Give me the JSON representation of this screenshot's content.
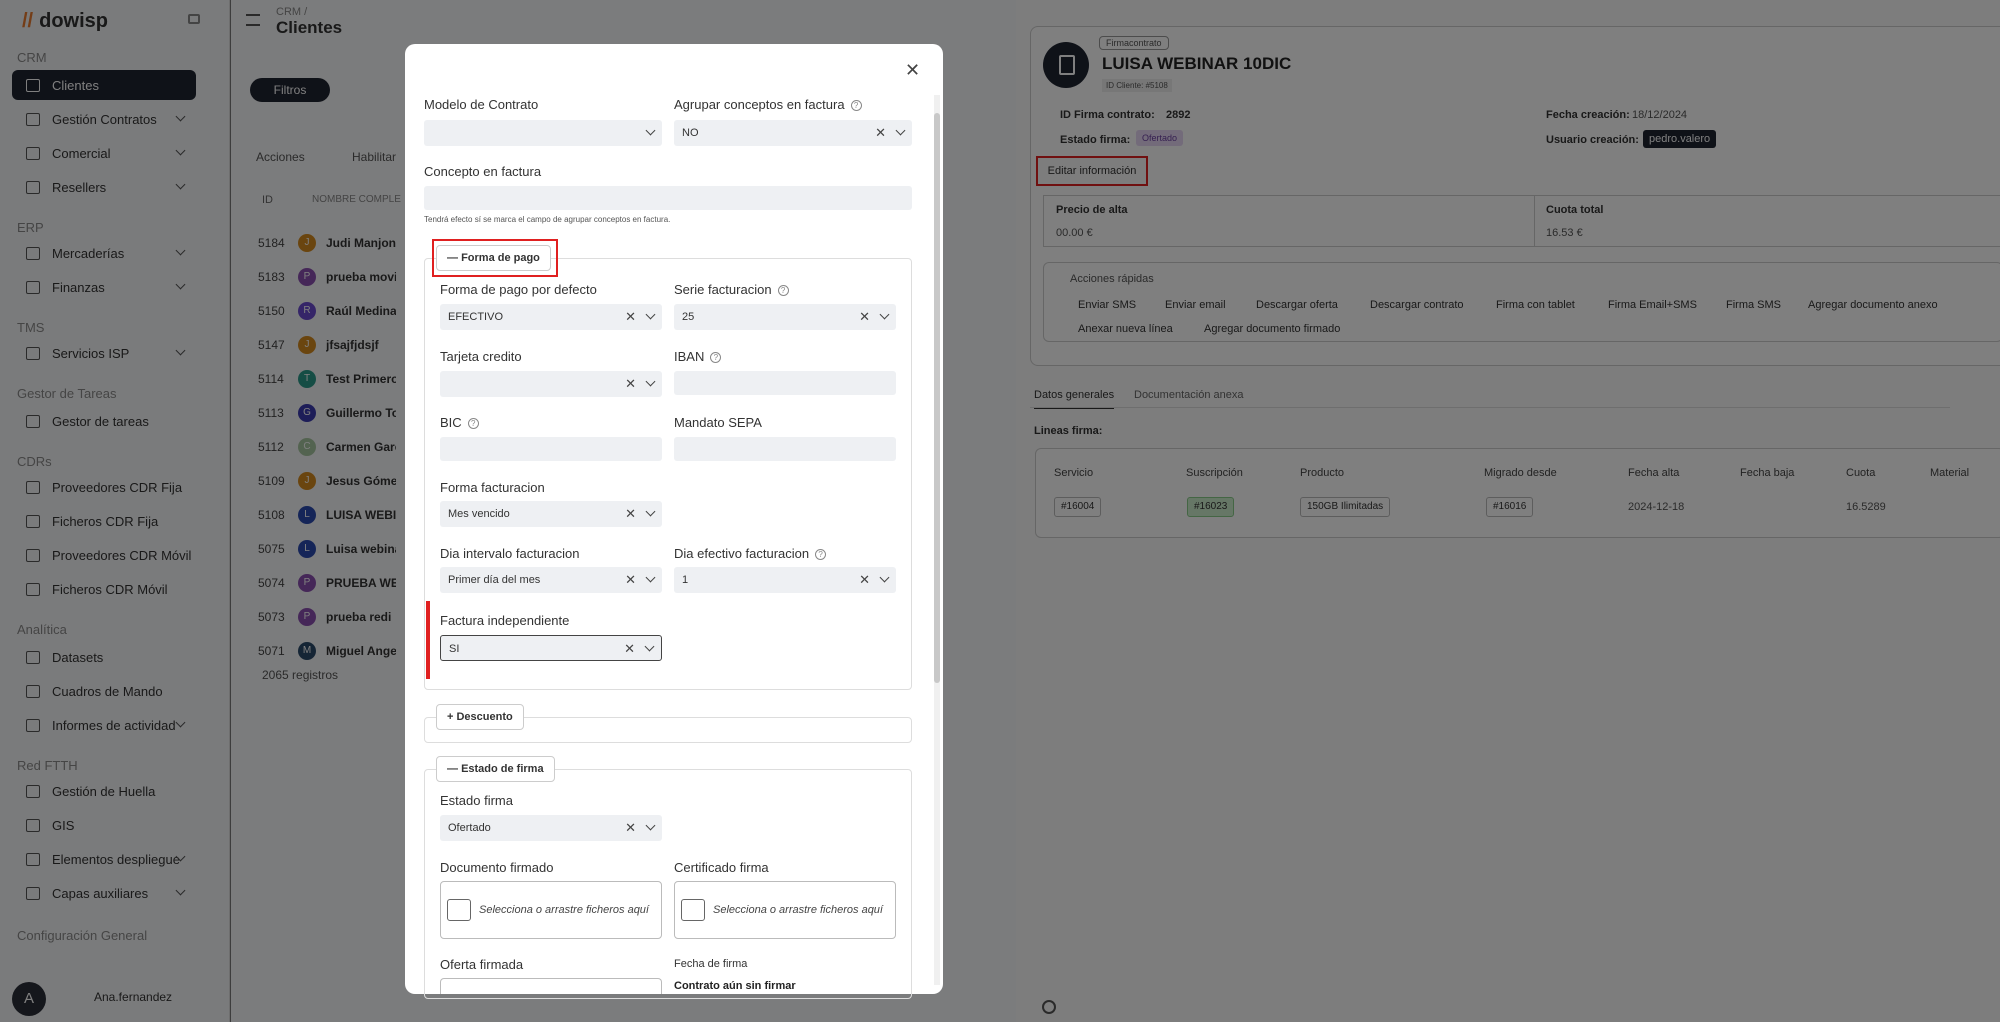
{
  "app": {
    "logo": "dowisp"
  },
  "sidebar": {
    "sections": [
      "CRM",
      "ERP",
      "TMS",
      "Gestor de Tareas",
      "CDRs",
      "Analítica",
      "Red FTTH",
      "Configuración General"
    ],
    "items": [
      {
        "label": "Clientes",
        "active": true
      },
      {
        "label": "Gestión Contratos",
        "chevron": true
      },
      {
        "label": "Comercial",
        "chevron": true
      },
      {
        "label": "Resellers",
        "chevron": true
      },
      {
        "label": "Mercaderías",
        "chevron": true
      },
      {
        "label": "Finanzas",
        "chevron": true
      },
      {
        "label": "Servicios ISP",
        "chevron": true
      },
      {
        "label": "Gestor de tareas"
      },
      {
        "label": "Proveedores CDR Fija"
      },
      {
        "label": "Ficheros CDR Fija"
      },
      {
        "label": "Proveedores CDR Móvil"
      },
      {
        "label": "Ficheros CDR Móvil"
      },
      {
        "label": "Datasets"
      },
      {
        "label": "Cuadros de Mando"
      },
      {
        "label": "Informes de actividad",
        "chevron": true
      },
      {
        "label": "Gestión de Huella"
      },
      {
        "label": "GIS"
      },
      {
        "label": "Elementos despliegue",
        "chevron": true
      },
      {
        "label": "Capas auxiliares",
        "chevron": true
      }
    ],
    "user": {
      "initial": "A",
      "name": "Ana.fernandez"
    }
  },
  "main": {
    "breadcrumb": "CRM /",
    "title": "Clientes",
    "filters": "Filtros",
    "actions": "Acciones",
    "habilitar": "Habilitar",
    "col_id": "ID",
    "col_name": "NOMBRE COMPLE",
    "rows": [
      {
        "id": "5184",
        "initial": "J",
        "name": "Judi Manjon",
        "color": "#d58a1e"
      },
      {
        "id": "5183",
        "initial": "P",
        "name": "prueba movil",
        "color": "#8a4fb0"
      },
      {
        "id": "5150",
        "initial": "R",
        "name": "Raúl Medina",
        "color": "#6a4ad0"
      },
      {
        "id": "5147",
        "initial": "J",
        "name": "jfsajfjdsjf",
        "color": "#d58a1e"
      },
      {
        "id": "5114",
        "initial": "T",
        "name": "Test Primero",
        "color": "#2a9a8a"
      },
      {
        "id": "5113",
        "initial": "G",
        "name": "Guillermo Tor",
        "color": "#3a3ab0"
      },
      {
        "id": "5112",
        "initial": "C",
        "name": "Carmen Garci",
        "color": "#a7c7a0"
      },
      {
        "id": "5109",
        "initial": "J",
        "name": "Jesus Gómez",
        "color": "#d58a1e"
      },
      {
        "id": "5108",
        "initial": "L",
        "name": "LUISA WEBIN",
        "color": "#2a4ab0"
      },
      {
        "id": "5075",
        "initial": "L",
        "name": "Luisa webinar",
        "color": "#2a4ab0"
      },
      {
        "id": "5074",
        "initial": "P",
        "name": "PRUEBA WEB",
        "color": "#8a4fb0"
      },
      {
        "id": "5073",
        "initial": "P",
        "name": "prueba redi",
        "color": "#8a4fb0"
      },
      {
        "id": "5071",
        "initial": "M",
        "name": "Miguel Angel",
        "color": "#2a4a6a"
      }
    ],
    "records": "2065 registros"
  },
  "right": {
    "tag": "Firmacontrato",
    "title": "LUISA WEBINAR 10DIC",
    "client_id": "ID Cliente: #5108",
    "firma_id_label": "ID Firma contrato:",
    "firma_id": "2892",
    "fecha_label": "Fecha creación:",
    "fecha": "18/12/2024",
    "estado_label": "Estado firma:",
    "estado": "Ofertado",
    "usuario_label": "Usuario creación:",
    "usuario": "pedro.valero",
    "edit": "Editar información",
    "precio_label": "Precio de alta",
    "precio": "00.00 €",
    "cuota_label": "Cuota total",
    "cuota": "16.53 €",
    "quick_title": "Acciones rápidas",
    "quick": [
      "Enviar SMS",
      "Enviar email",
      "Descargar oferta",
      "Descargar contrato",
      "Firma con tablet",
      "Firma Email+SMS",
      "Firma SMS",
      "Agregar documento anexo",
      "Anexar nueva línea",
      "Agregar documento firmado"
    ],
    "tabs": [
      "Datos generales",
      "Documentación anexa"
    ],
    "lines_title": "Lineas firma:",
    "headers": [
      "Servicio",
      "Suscripción",
      "Producto",
      "Migrado desde",
      "Fecha alta",
      "Fecha baja",
      "Cuota",
      "Material"
    ],
    "row": {
      "servicio": "#16004",
      "suscripcion": "#16023",
      "producto": "150GB Ilimitadas",
      "migrado": "#16016",
      "alta": "2024-12-18",
      "cuota": "16.5289"
    }
  },
  "modal": {
    "modelo_label": "Modelo de Contrato",
    "agrupar_label": "Agrupar conceptos en factura",
    "agrupar_val": "NO",
    "concepto_label": "Concepto en factura",
    "concepto_hint": "Tendrá efecto sí se marca el campo de agrupar conceptos en factura.",
    "forma_pago_section": "Forma de pago",
    "forma_pago_label": "Forma de pago por defecto",
    "forma_pago_val": "EFECTIVO",
    "serie_label": "Serie facturacion",
    "serie_val": "25",
    "tarjeta_label": "Tarjeta credito",
    "iban_label": "IBAN",
    "bic_label": "BIC",
    "mandato_label": "Mandato SEPA",
    "forma_fact_label": "Forma facturacion",
    "forma_fact_val": "Mes vencido",
    "dia_int_label": "Dia intervalo facturacion",
    "dia_int_val": "Primer día del mes",
    "dia_ef_label": "Dia efectivo facturacion",
    "dia_ef_val": "1",
    "fact_ind_label": "Factura independiente",
    "fact_ind_val": "SI",
    "descuento_section": "Descuento",
    "estado_section": "Estado de firma",
    "estado_label": "Estado firma",
    "estado_val": "Ofertado",
    "doc_firmado_label": "Documento firmado",
    "cert_label": "Certificado firma",
    "upload_text": "Selecciona o arrastre ficheros aquí",
    "oferta_label": "Oferta firmada",
    "fecha_firma_label": "Fecha de firma",
    "fecha_firma_val": "Contrato aún sin firmar"
  }
}
